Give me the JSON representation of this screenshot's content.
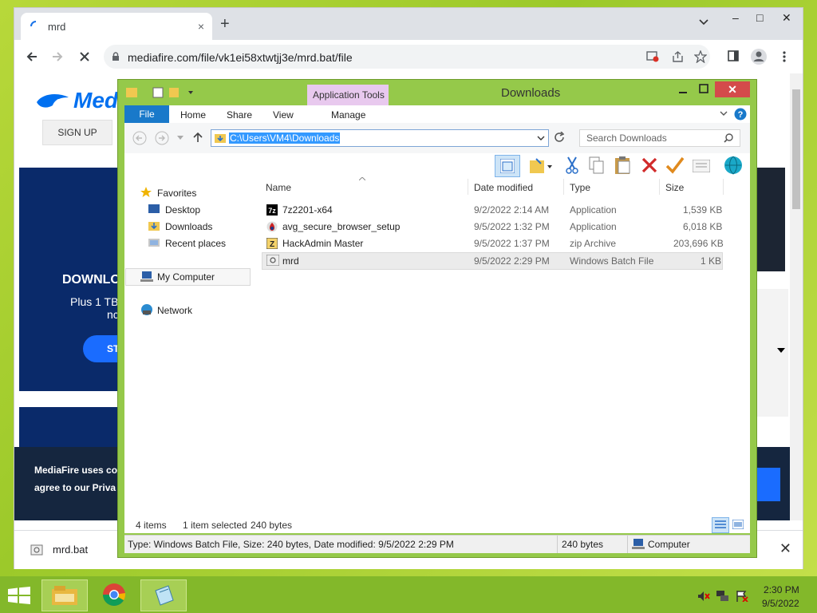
{
  "browser": {
    "tab_title": "mrd",
    "tab_close": "×",
    "new_tab": "+",
    "url": "mediafire.com/file/vk1ei58xtwtjj3e/mrd.bat/file",
    "window_controls": {
      "minimize": "–",
      "maximize": "□",
      "close": "✕"
    }
  },
  "mediafire": {
    "logo": "Medi",
    "signup": "SIGN UP",
    "hero_line1": "DOWNLO",
    "hero_line2": "Plus 1 TB",
    "hero_line3": "nc",
    "hero_button": "ST",
    "cookie_line1": "MediaFire uses co",
    "cookie_line2": "agree to our Priva"
  },
  "download_bar": {
    "filename": "mrd.bat",
    "close": "✕"
  },
  "explorer": {
    "title": "Downloads",
    "app_tools": "Application Tools",
    "ribbon_tabs": {
      "file": "File",
      "home": "Home",
      "share": "Share",
      "view": "View",
      "manage": "Manage"
    },
    "address": "C:\\Users\\VM4\\Downloads",
    "search_placeholder": "Search Downloads",
    "nav": {
      "favorites": "Favorites",
      "desktop": "Desktop",
      "downloads": "Downloads",
      "recent": "Recent places",
      "my_computer": "My Computer",
      "network": "Network"
    },
    "columns": {
      "name": "Name",
      "date": "Date modified",
      "type": "Type",
      "size": "Size"
    },
    "files": [
      {
        "name": "7z2201-x64",
        "date": "9/2/2022 2:14 AM",
        "type": "Application",
        "size": "1,539 KB"
      },
      {
        "name": "avg_secure_browser_setup",
        "date": "9/5/2022 1:32 PM",
        "type": "Application",
        "size": "6,018 KB"
      },
      {
        "name": "HackAdmin Master",
        "date": "9/5/2022 1:37 PM",
        "type": "zip Archive",
        "size": "203,696 KB"
      },
      {
        "name": "mrd",
        "date": "9/5/2022 2:29 PM",
        "type": "Windows Batch File",
        "size": "1 KB"
      }
    ],
    "status": {
      "items": "4 items",
      "selected": "1 item selected",
      "bytes": "240 bytes"
    },
    "details": {
      "info": "Type: Windows Batch File, Size: 240 bytes, Date modified: 9/5/2022 2:29 PM",
      "size": "240 bytes",
      "location": "Computer"
    }
  },
  "taskbar": {
    "time": "2:30 PM",
    "date": "9/5/2022"
  }
}
